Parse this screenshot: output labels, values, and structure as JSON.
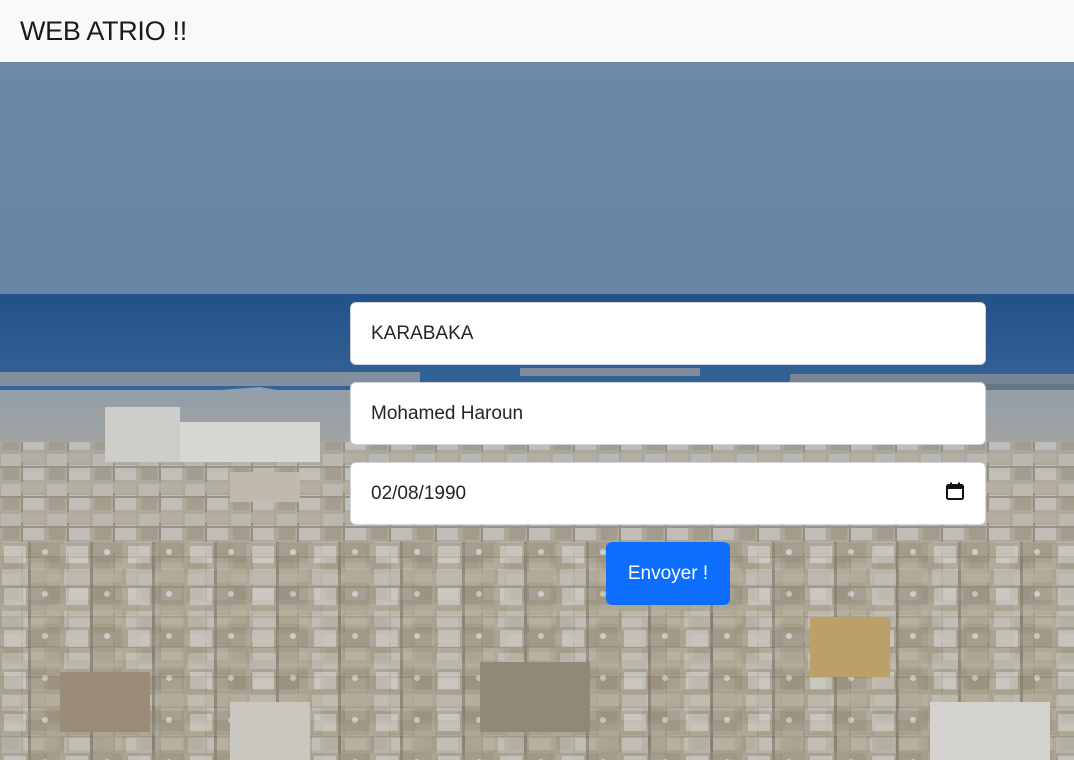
{
  "navbar": {
    "brand": "WEB ATRIO !!"
  },
  "form": {
    "last_name_value": "KARABAKA",
    "first_name_value": "Mohamed Haroun",
    "birth_date_value": "02/08/1990",
    "submit_label": "Envoyer !"
  },
  "icons": {
    "date_picker": "calendar-icon"
  },
  "colors": {
    "navbar_bg": "#f8f9fa",
    "button_primary": "#0d6efd",
    "sky": "#7390ae",
    "sea": "#2a5a92"
  }
}
